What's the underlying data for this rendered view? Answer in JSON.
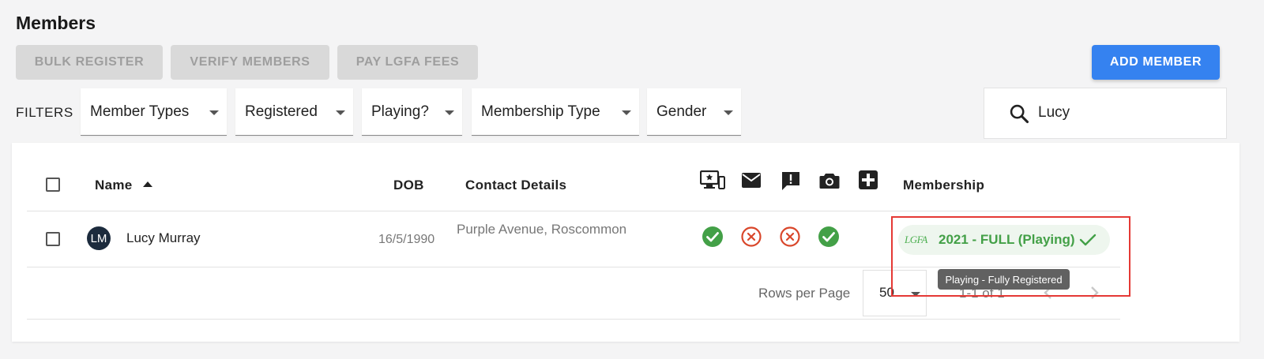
{
  "page": {
    "title": "Members"
  },
  "actions": {
    "bulk_register": "BULK REGISTER",
    "verify_members": "VERIFY MEMBERS",
    "pay_fees": "PAY LGFA FEES",
    "add_member": "ADD MEMBER"
  },
  "filters": {
    "label": "FILTERS",
    "items": [
      {
        "label": "Member Types"
      },
      {
        "label": "Registered"
      },
      {
        "label": "Playing?"
      },
      {
        "label": "Membership Type"
      },
      {
        "label": "Gender"
      }
    ]
  },
  "search": {
    "value": "Lucy"
  },
  "table": {
    "headers": {
      "name": "Name",
      "dob": "DOB",
      "contact": "Contact Details",
      "membership": "Membership"
    },
    "header_icons": [
      "online-registration-icon",
      "email-icon",
      "alert-message-icon",
      "camera-icon",
      "medical-icon"
    ],
    "rows": [
      {
        "initials": "LM",
        "name": "Lucy Murray",
        "dob": "16/5/1990",
        "address": "Purple Avenue, Roscommon",
        "statuses": [
          {
            "icon": "check-circle-icon",
            "state": "ok"
          },
          {
            "icon": "cancel-circle-icon",
            "state": "missing"
          },
          {
            "icon": "cancel-circle-icon",
            "state": "missing"
          },
          {
            "icon": "check-circle-icon",
            "state": "ok"
          }
        ],
        "membership": {
          "logo": "LGFA",
          "label": "2021 - FULL (Playing)"
        }
      }
    ]
  },
  "tooltip": "Playing - Fully Registered",
  "pagination": {
    "rows_label": "Rows per Page",
    "rows_value": "50",
    "range": "1-1 of 1"
  },
  "colors": {
    "primary": "#3582f0",
    "success": "#43a047",
    "error": "#d9472b",
    "highlight": "#e53935"
  }
}
